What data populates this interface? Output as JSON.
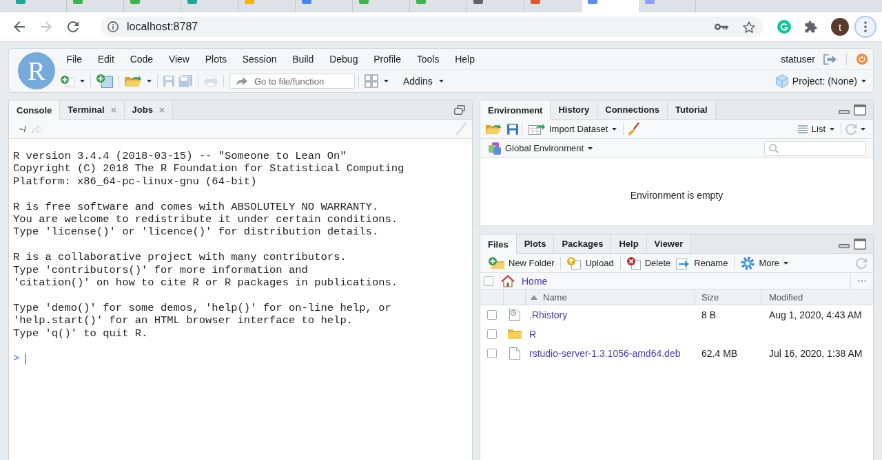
{
  "browser": {
    "tabs": [
      {
        "selected": false,
        "color": "#1fa59a"
      },
      {
        "selected": false,
        "color": "#3cb44b"
      },
      {
        "selected": false,
        "color": "#3cb44b"
      },
      {
        "selected": false,
        "color": "#1fa59a"
      },
      {
        "selected": false,
        "color": "#f4b400"
      },
      {
        "selected": false,
        "color": "#4a86e8"
      },
      {
        "selected": false,
        "color": "#3cb44b"
      },
      {
        "selected": false,
        "color": "#3cb44b"
      },
      {
        "selected": false,
        "color": "#5f6368"
      },
      {
        "selected": false,
        "color": "#e8542a"
      },
      {
        "selected": true,
        "color": "#5b8def"
      },
      {
        "selected": false,
        "color": "#8c9eff"
      }
    ],
    "forward_disabled": true,
    "address": "localhost:8787",
    "profile_initial": "t",
    "menu_focused": true
  },
  "app": {
    "logo": "R",
    "menu": [
      "File",
      "Edit",
      "Code",
      "View",
      "Plots",
      "Session",
      "Build",
      "Debug",
      "Profile",
      "Tools",
      "Help"
    ],
    "user": "statuser",
    "toolbar": [
      {
        "kind": "new-file",
        "disabled": false,
        "dropdown": true
      },
      {
        "kind": "new-project",
        "disabled": false,
        "dropdown": false
      },
      {
        "kind": "open",
        "disabled": false,
        "dropdown": true
      },
      {
        "kind": "save",
        "disabled": true,
        "dropdown": false
      },
      {
        "kind": "save-all",
        "disabled": true,
        "dropdown": false
      },
      {
        "kind": "print",
        "disabled": true,
        "dropdown": false
      }
    ],
    "goto": {
      "placeholder": "Go to file/function"
    },
    "addins": "Addins",
    "project": "Project: (None)"
  },
  "console_pane": {
    "tabs": [
      {
        "label": "Console",
        "selected": true,
        "closable": false
      },
      {
        "label": "Terminal",
        "selected": false,
        "closable": true
      },
      {
        "label": "Jobs",
        "selected": false,
        "closable": true
      }
    ],
    "path": "~/",
    "output": [
      [
        "R version 3.4.4 (2018-03-15) -- \"Someone to Lean On\"",
        "Copyright (C) 2018 The R Foundation for Statistical Computing",
        "Platform: x86_64-pc-linux-gnu (64-bit)"
      ],
      [
        "R is free software and comes with ABSOLUTELY NO WARRANTY.",
        "You are welcome to redistribute it under certain conditions.",
        "Type 'license()' or 'licence()' for distribution details."
      ],
      [
        "R is a collaborative project with many contributors.",
        "Type 'contributors()' for more information and",
        "'citation()' on how to cite R or R packages in publications."
      ],
      [
        "Type 'demo()' for some demos, 'help()' for on-line help, or",
        "'help.start()' for an HTML browser interface to help.",
        "Type 'q()' to quit R."
      ]
    ],
    "prompt": ">"
  },
  "environment_pane": {
    "tabs": [
      {
        "label": "Environment",
        "selected": true
      },
      {
        "label": "History",
        "selected": false
      },
      {
        "label": "Connections",
        "selected": false
      },
      {
        "label": "Tutorial",
        "selected": false
      }
    ],
    "import_label": "Import Dataset",
    "view_mode": "List",
    "scope": "Global Environment",
    "empty_message": "Environment is empty"
  },
  "files_pane": {
    "tabs": [
      {
        "label": "Files",
        "selected": true
      },
      {
        "label": "Plots",
        "selected": false
      },
      {
        "label": "Packages",
        "selected": false
      },
      {
        "label": "Help",
        "selected": false
      },
      {
        "label": "Viewer",
        "selected": false
      }
    ],
    "actions": [
      {
        "label": "New Folder",
        "kind": "new-folder"
      },
      {
        "label": "Upload",
        "kind": "upload"
      },
      {
        "label": "Delete",
        "kind": "delete"
      },
      {
        "label": "Rename",
        "kind": "rename"
      },
      {
        "label": "More",
        "kind": "more"
      }
    ],
    "select_all_checked": false,
    "breadcrumb": "Home",
    "columns": [
      {
        "label": "Name",
        "sorted": true
      },
      {
        "label": "Size",
        "sorted": false
      },
      {
        "label": "Modified",
        "sorted": false
      }
    ],
    "rows": [
      {
        "name": ".Rhistory",
        "kind": "history",
        "size": "8 B",
        "modified": "Aug 1, 2020, 4:43 AM",
        "checked": false
      },
      {
        "name": "R",
        "kind": "folder",
        "checked": false
      },
      {
        "name": "rstudio-server-1.3.1056-amd64.deb",
        "kind": "file",
        "size": "62.4 MB",
        "modified": "Jul 16, 2020, 1:38 AM",
        "checked": false
      }
    ]
  }
}
